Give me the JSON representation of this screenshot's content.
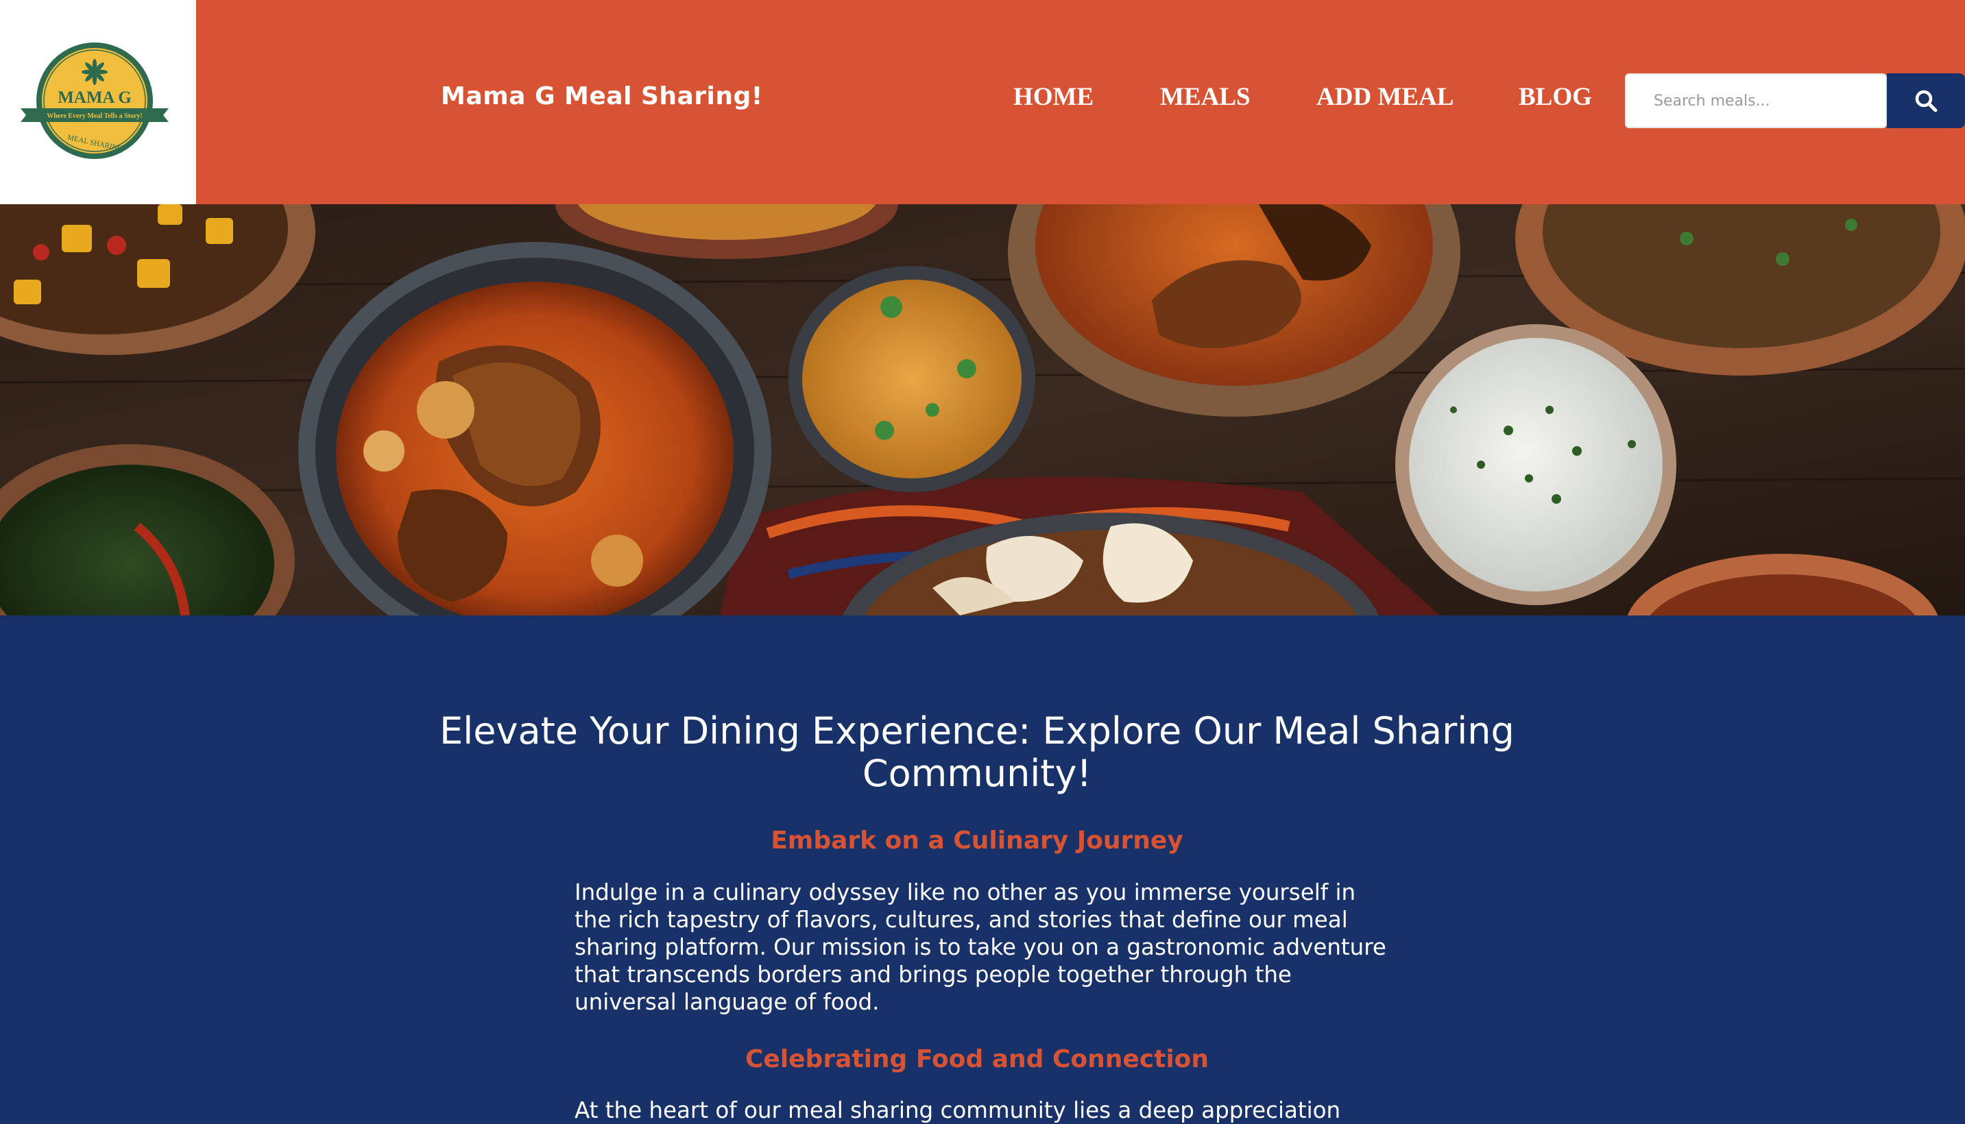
{
  "logo": {
    "title": "MAMA G",
    "tagline": "Where Every Meal Tells a Story!",
    "ribbon": "MEAL SHARING"
  },
  "header": {
    "site_title": "Mama G Meal Sharing!",
    "nav": [
      {
        "label": "HOME"
      },
      {
        "label": "MEALS"
      },
      {
        "label": "ADD MEAL"
      },
      {
        "label": "BLOG"
      }
    ],
    "search": {
      "placeholder": "Search meals...",
      "value": ""
    }
  },
  "colors": {
    "header_bg": "#D85234",
    "content_bg": "#183169",
    "accent": "#D85234",
    "logo_green": "#2E6B4E",
    "logo_gold": "#F2BE3E"
  },
  "icons": {
    "search_button": "search-icon",
    "logo_emblem": "star-anise-icon"
  },
  "content": {
    "heading": "Elevate Your Dining Experience: Explore Our Meal Sharing Community!",
    "sections": [
      {
        "subheading": "Embark on a Culinary Journey",
        "text": "Indulge in a culinary odyssey like no other as you immerse yourself in the rich tapestry of flavors, cultures, and stories that define our meal sharing platform. Our mission is to take you on a gastronomic adventure that transcends borders and brings people together through the universal language of food."
      },
      {
        "subheading": "Celebrating Food and Connection",
        "text": "At the heart of our meal sharing community lies a deep appreciation"
      }
    ]
  }
}
